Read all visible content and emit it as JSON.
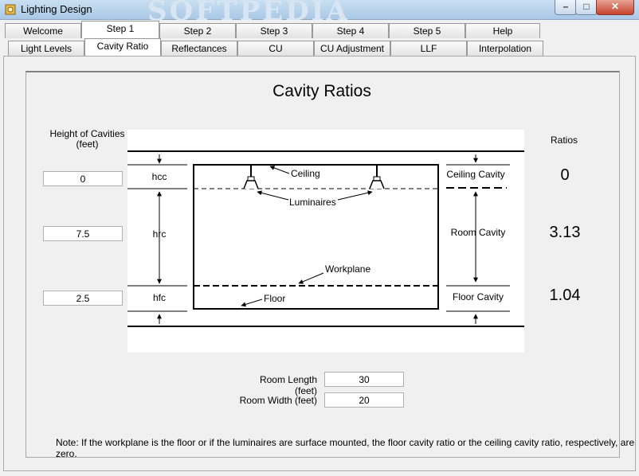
{
  "window": {
    "title": "Lighting Design",
    "watermark": "SOFTPEDIA"
  },
  "tabs_main": [
    {
      "label": "Welcome"
    },
    {
      "label": "Step 1"
    },
    {
      "label": "Step 2"
    },
    {
      "label": "Step 3"
    },
    {
      "label": "Step 4"
    },
    {
      "label": "Step 5"
    },
    {
      "label": "Help"
    }
  ],
  "tabs_sub": [
    {
      "label": "Light Levels"
    },
    {
      "label": "Cavity Ratio"
    },
    {
      "label": "Reflectances"
    },
    {
      "label": "CU"
    },
    {
      "label": "CU Adjustment"
    },
    {
      "label": "LLF"
    },
    {
      "label": "Interpolation"
    }
  ],
  "page": {
    "title": "Cavity Ratios",
    "heights_header": "Height of Cavities (feet)",
    "ratios_header": "Ratios"
  },
  "heights": {
    "hcc": "0",
    "hrc": "7.5",
    "hfc": "2.5"
  },
  "ratios": {
    "ceiling": "0",
    "room": "3.13",
    "floor": "1.04"
  },
  "diagram": {
    "hcc": "hcc",
    "hrc": "hrc",
    "hfc": "hfc",
    "ceiling": "Ceiling",
    "luminaires": "Luminaires",
    "workplane": "Workplane",
    "floor": "Floor",
    "ceiling_cavity": "Ceiling Cavity",
    "room_cavity": "Room Cavity",
    "floor_cavity": "Floor Cavity"
  },
  "room": {
    "length_label": "Room Length (feet)",
    "length_value": "30",
    "width_label": "Room Width (feet)",
    "width_value": "20"
  },
  "note": "Note: If the workplane is the floor or if the luminaires are surface mounted, the floor cavity ratio or the ceiling cavity ratio, respectively, are zero."
}
